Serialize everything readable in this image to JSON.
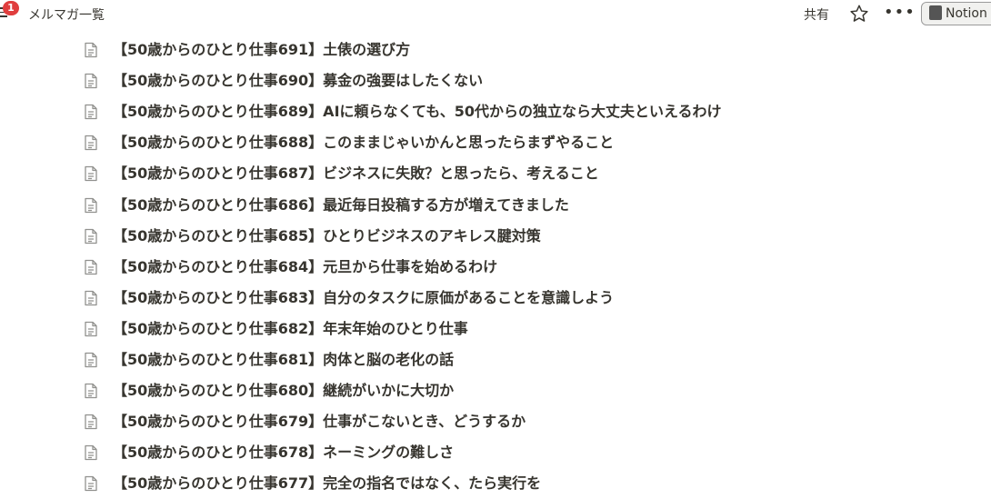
{
  "topbar": {
    "notification_count": "1",
    "title": "メルマガ一覧",
    "share_label": "共有",
    "star_icon": "star-icon",
    "more_label": "•••",
    "app_button_label": "Notion"
  },
  "pages": [
    "【50歳からのひとり仕事691】土俵の選び方",
    "【50歳からのひとり仕事690】募金の強要はしたくない",
    "【50歳からのひとり仕事689】AIに頼らなくても、50代からの独立なら大丈夫といえるわけ",
    "【50歳からのひとり仕事688】このままじゃいかんと思ったらまずやること",
    "【50歳からのひとり仕事687】ビジネスに失敗？と思ったら、考えること",
    "【50歳からのひとり仕事686】最近毎日投稿する方が増えてきました",
    "【50歳からのひとり仕事685】ひとりビジネスのアキレス腱対策",
    "【50歳からのひとり仕事684】元旦から仕事を始めるわけ",
    "【50歳からのひとり仕事683】自分のタスクに原価があることを意識しよう",
    "【50歳からのひとり仕事682】年末年始のひとり仕事",
    "【50歳からのひとり仕事681】肉体と脳の老化の話",
    "【50歳からのひとり仕事680】継続がいかに大切か",
    "【50歳からのひとり仕事679】仕事がこないとき、どうするか",
    "【50歳からのひとり仕事678】ネーミングの難しさ",
    "【50歳からのひとり仕事677】完全の指名ではなく、たら実行を"
  ]
}
